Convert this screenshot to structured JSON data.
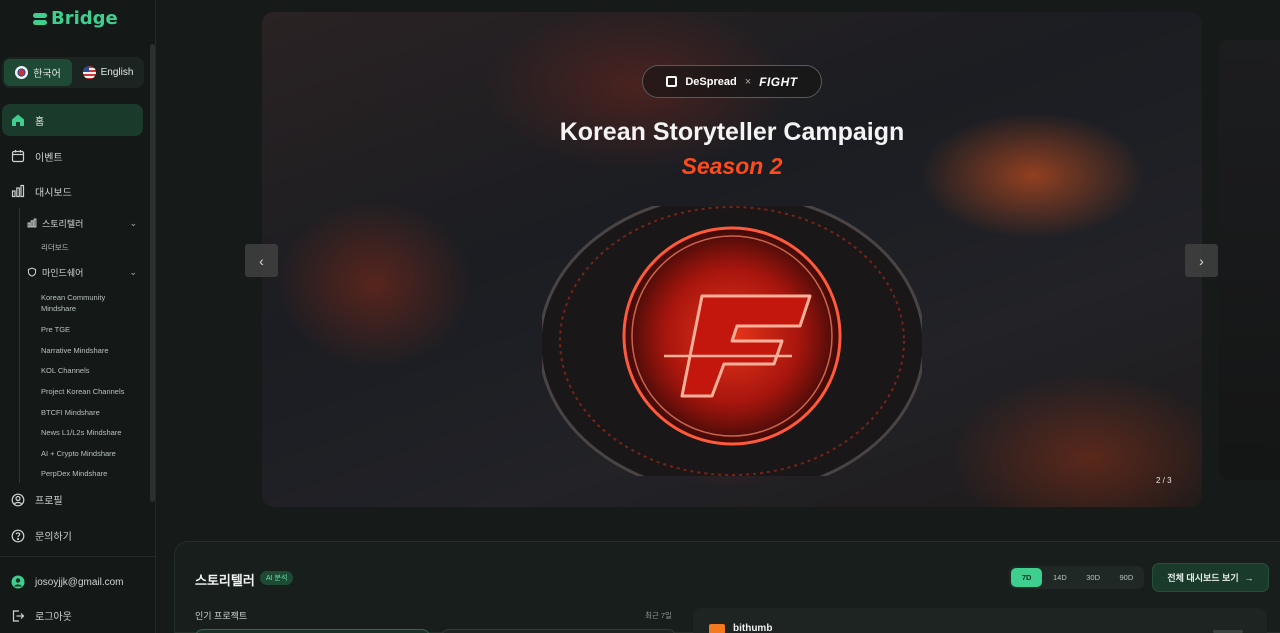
{
  "brand": {
    "name": "Bridge",
    "accent": "#3ecf8e"
  },
  "lang": {
    "ko": "한국어",
    "en": "English"
  },
  "nav": {
    "home": "홈",
    "events": "이벤트",
    "dashboard": "대시보드",
    "storyteller": "스토리텔러",
    "leaderboard": "리더보드",
    "mindshare": "마인드쉐어",
    "mindshare_items": [
      "Korean Community Mindshare",
      "Pre TGE",
      "Narrative Mindshare",
      "KOL Channels",
      "Project Korean Channels",
      "BTCFI Mindshare",
      "News L1/L2s Mindshare",
      "AI + Crypto Mindshare",
      "PerpDex Mindshare"
    ],
    "profile": "프로필",
    "contact": "문의하기"
  },
  "user": {
    "email": "josoyjjk@gmail.com",
    "logout": "로그아웃"
  },
  "hero": {
    "partner1": "DeSpread",
    "separator": "×",
    "partner2": "FIGHT",
    "title": "Korean Storyteller Campaign",
    "subtitle": "Season 2",
    "counter": "2 / 3",
    "prev_icon": "chevron-left-icon",
    "next_icon": "chevron-right-icon"
  },
  "storyteller_panel": {
    "title": "스토리텔러",
    "badge": "AI 분석",
    "periods": [
      "7D",
      "14D",
      "30D",
      "90D"
    ],
    "active_period": "7D",
    "full_dashboard": "전체 대시보드 보기",
    "popular_projects": "인기 프로젝트",
    "recent": "최근 7일",
    "card_brand": "bithumb"
  }
}
